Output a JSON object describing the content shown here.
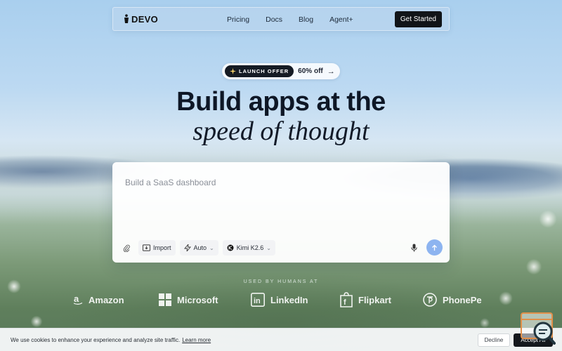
{
  "nav": {
    "logo_text": "DEVO",
    "links": [
      "Pricing",
      "Docs",
      "Blog",
      "Agent+"
    ],
    "cta": "Get Started"
  },
  "offer": {
    "tag": "LAUNCH OFFER",
    "text": "60% off"
  },
  "hero": {
    "title": "Build apps at the",
    "subtitle": "speed of thought"
  },
  "prompt": {
    "placeholder": "Build a SaaS dashboard",
    "tools": {
      "import": "Import",
      "mode": "Auto",
      "model": "Kimi K2.6"
    }
  },
  "used_by": {
    "label": "USED BY HUMANS AT",
    "brands": [
      "Amazon",
      "Microsoft",
      "LinkedIn",
      "Flipkart",
      "PhonePe"
    ]
  },
  "cookie": {
    "text": "We use cookies to enhance your experience and analyze site traffic.",
    "link": "Learn more",
    "decline": "Decline",
    "accept": "Accept All"
  },
  "colors": {
    "dark": "#111418",
    "send_button": "#8db4f0"
  }
}
